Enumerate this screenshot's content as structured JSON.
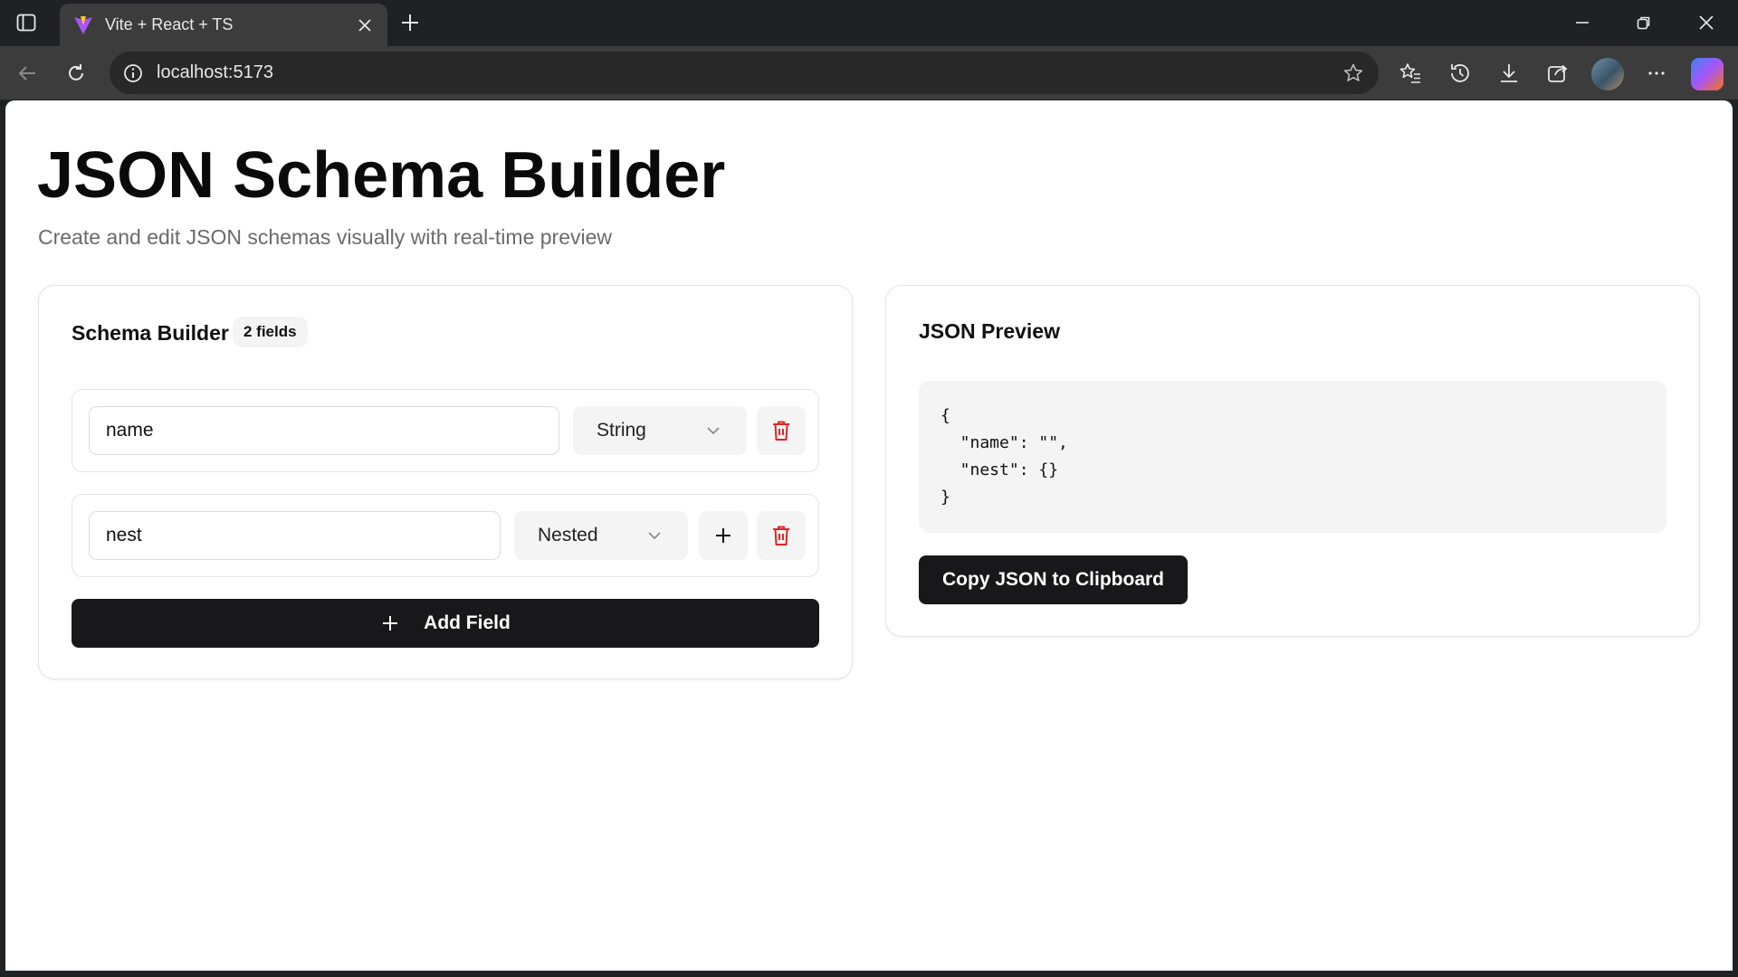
{
  "browser": {
    "tab_title": "Vite + React + TS",
    "url": "localhost:5173"
  },
  "page": {
    "title": "JSON Schema Builder",
    "subtitle": "Create and edit JSON schemas visually with real-time preview"
  },
  "builder": {
    "title": "Schema Builder",
    "field_count_badge": "2 fields",
    "fields": [
      {
        "name": "name",
        "type": "String",
        "has_add_child": false
      },
      {
        "name": "nest",
        "type": "Nested",
        "has_add_child": true
      }
    ],
    "add_field_label": "Add Field"
  },
  "preview": {
    "title": "JSON Preview",
    "json_text": "{\n  \"name\": \"\",\n  \"nest\": {}\n}",
    "copy_label": "Copy JSON to Clipboard"
  },
  "colors": {
    "delete_icon": "#dc2626",
    "primary_button": "#18181b",
    "muted_bg": "#f4f4f5"
  }
}
